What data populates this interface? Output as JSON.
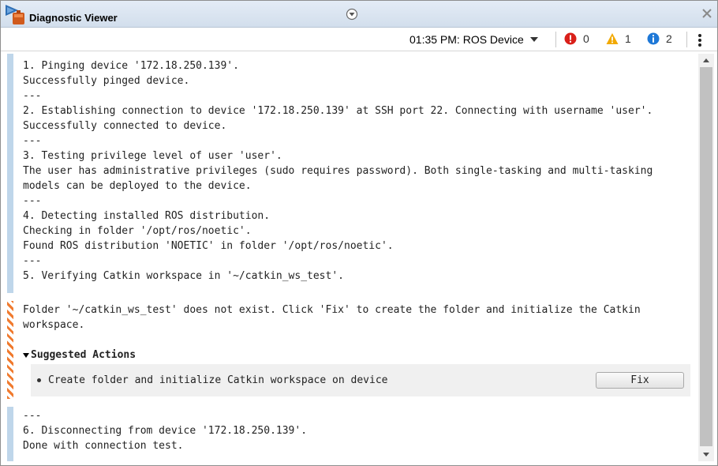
{
  "window": {
    "title": "Diagnostic Viewer"
  },
  "toolbar": {
    "session_label": "01:35 PM: ROS Device",
    "errors": "0",
    "warnings": "1",
    "info": "2"
  },
  "log": {
    "block1": [
      "1. Pinging device '172.18.250.139'.",
      "Successfully pinged device.",
      "---",
      "2. Establishing connection to device '172.18.250.139' at SSH port 22. Connecting with username 'user'.",
      "Successfully connected to device.",
      "---",
      "3. Testing privilege level of user 'user'.",
      "The user has administrative privileges (sudo requires password). Both single-tasking and multi-tasking",
      "models can be deployed to the device.",
      "---",
      "4. Detecting installed ROS distribution.",
      "Checking in folder '/opt/ros/noetic'.",
      "Found ROS distribution 'NOETIC' in folder '/opt/ros/noetic'.",
      "---",
      "5. Verifying Catkin workspace in '~/catkin_ws_test'."
    ],
    "warning": [
      "Folder '~/catkin_ws_test' does not exist. Click 'Fix' to create the folder and initialize the Catkin",
      "workspace."
    ],
    "suggested_title": "Suggested Actions",
    "action_text": "Create folder and initialize Catkin workspace on device",
    "fix_label": "Fix",
    "block2": [
      "---",
      "6. Disconnecting from device '172.18.250.139'.",
      "Done with connection test."
    ]
  },
  "colors": {
    "error": "#d9201a",
    "warning": "#f2a900",
    "info": "#1e78d7",
    "bar_blue": "#bfd6ea",
    "bar_warning": "#f07a2e"
  }
}
